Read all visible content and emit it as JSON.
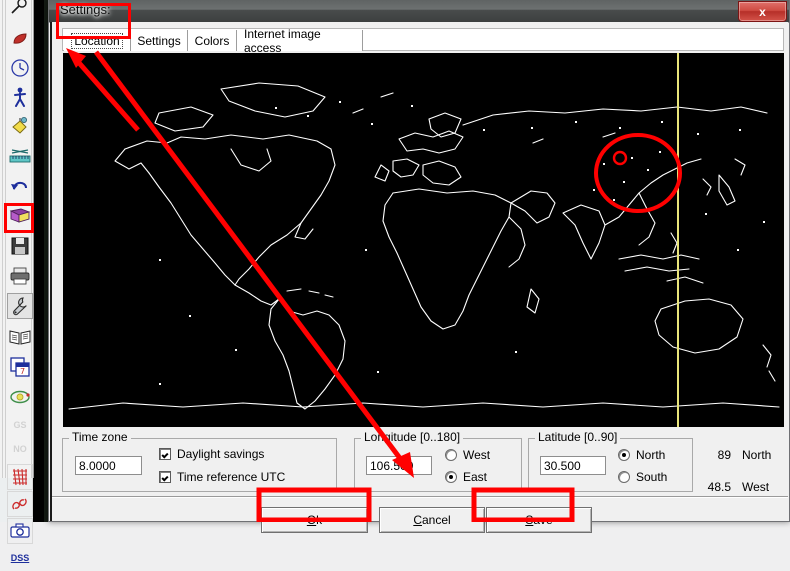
{
  "window": {
    "title": "Settings:",
    "close_label": "x"
  },
  "tabs": [
    {
      "label": "Location",
      "active": true
    },
    {
      "label": "Settings",
      "active": false
    },
    {
      "label": "Colors",
      "active": false
    },
    {
      "label": "Internet image access",
      "active": false
    }
  ],
  "map": {
    "description": "world-map-black-background-white-coastlines",
    "meridian_color": "#e8e47a",
    "selection_marker_color": "#ff0000"
  },
  "timezone": {
    "legend": "Time zone",
    "value": "8.0000",
    "daylight_savings_label": "Daylight savings",
    "daylight_savings_checked": true,
    "time_reference_utc_label": "Time reference UTC",
    "time_reference_utc_checked": true
  },
  "longitude": {
    "legend": "Longitude [0..180]",
    "value": "106.500",
    "options": [
      {
        "label": "West",
        "selected": false
      },
      {
        "label": "East",
        "selected": true
      }
    ]
  },
  "latitude": {
    "legend": "Latitude [0..90]",
    "value": "30.500",
    "options": [
      {
        "label": "North",
        "selected": true
      },
      {
        "label": "South",
        "selected": false
      }
    ]
  },
  "cursor_readout": {
    "row1_value": "89",
    "row1_hemisphere": "North",
    "row2_value": "48.5",
    "row2_hemisphere": "West"
  },
  "buttons": {
    "ok": "Ok",
    "ok_accel": "O",
    "cancel": "Cancel",
    "cancel_accel": "C",
    "save": "Save",
    "save_accel": "S"
  },
  "toolbar": {
    "items": [
      {
        "name": "find-icon",
        "glyph": "search"
      },
      {
        "name": "leaf-icon",
        "glyph": "leaf"
      },
      {
        "name": "clock-icon",
        "glyph": "clock"
      },
      {
        "name": "walking-person-icon",
        "glyph": "person"
      },
      {
        "name": "paint-bucket-icon",
        "glyph": "bucket"
      },
      {
        "name": "ruler-icon",
        "glyph": "ruler"
      },
      {
        "name": "undo-icon",
        "glyph": "undo"
      },
      {
        "name": "book-purple-icon",
        "glyph": "book"
      },
      {
        "name": "save-disk-icon",
        "glyph": "disk"
      },
      {
        "name": "print-icon",
        "glyph": "printer"
      },
      {
        "name": "wrench-settings-icon",
        "glyph": "wrench",
        "selected": true
      },
      {
        "name": "open-book-icon",
        "glyph": "openbook"
      },
      {
        "name": "calendar-icon",
        "glyph": "calendar"
      },
      {
        "name": "orbit-icon",
        "glyph": "orbit"
      },
      {
        "name": "gs-label-icon",
        "glyph": "text",
        "text": "GS",
        "disabled": true
      },
      {
        "name": "no-label-icon",
        "glyph": "text",
        "text": "NO",
        "disabled": true
      },
      {
        "name": "grid-red-icon",
        "glyph": "grid"
      },
      {
        "name": "link-chain-icon",
        "glyph": "chain"
      },
      {
        "name": "camera-icon",
        "glyph": "camera"
      },
      {
        "name": "dss-label-icon",
        "glyph": "text",
        "text": "DSS"
      }
    ]
  },
  "annotations": {
    "color": "#ff0000",
    "items": [
      {
        "name": "location-tab-highlight",
        "shape": "rect"
      },
      {
        "name": "wrench-toolbar-highlight",
        "shape": "rect"
      },
      {
        "name": "arrow-to-location-tab",
        "shape": "arrow"
      },
      {
        "name": "arrow-to-longitude-field",
        "shape": "arrow"
      },
      {
        "name": "china-region-circle",
        "shape": "circle"
      },
      {
        "name": "ok-button-highlight",
        "shape": "rect"
      },
      {
        "name": "save-button-highlight",
        "shape": "rect"
      }
    ]
  }
}
